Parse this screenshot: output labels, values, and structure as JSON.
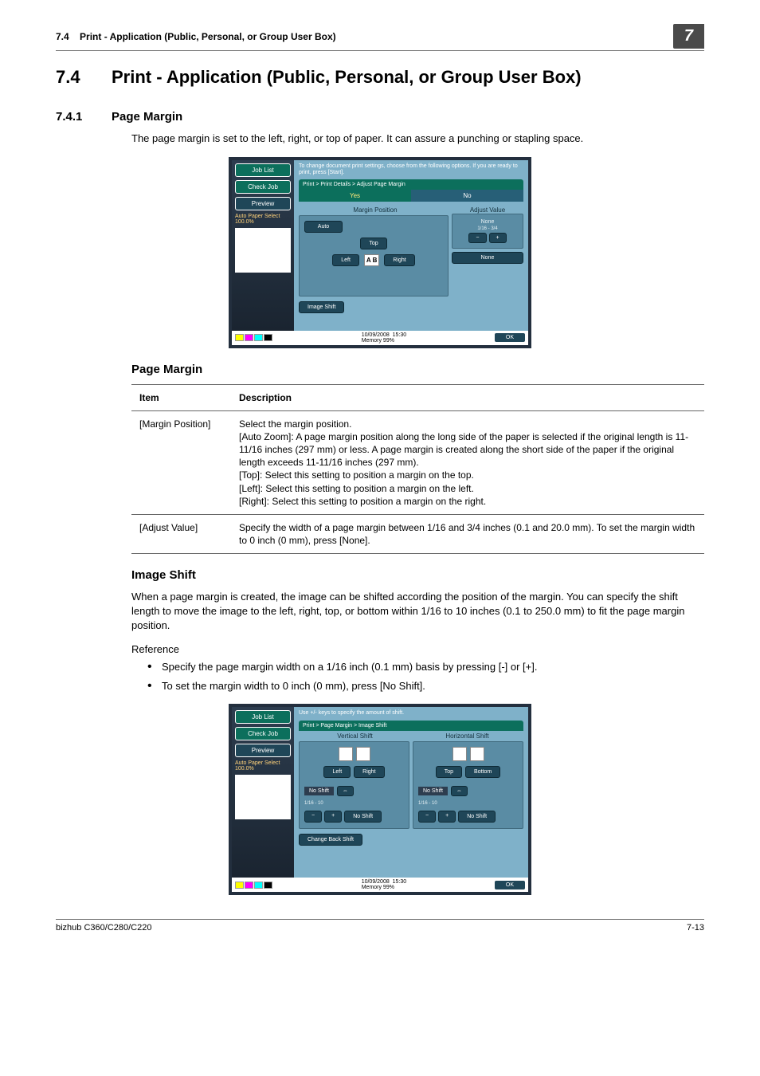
{
  "header": {
    "section_num": "7.4",
    "section_title": "Print - Application (Public, Personal, or Group User Box)",
    "chapter_badge": "7"
  },
  "h1": {
    "num": "7.4",
    "title": "Print - Application (Public, Personal, or Group User Box)"
  },
  "sec1": {
    "num": "7.4.1",
    "title": "Page Margin",
    "body": "The page margin is set to the left, right, or top of paper. It can assure a punching or stapling space."
  },
  "shot1": {
    "side_joblist": "Job List",
    "side_checkjob": "Check Job",
    "side_preview": "Preview",
    "side_autopaper": "Auto Paper Select  100.0%",
    "instr": "To change document print settings, choose from the following options. If you are ready to print, press [Start].",
    "breadcrumb": "Print > Print Details > Adjust Page Margin",
    "yes": "Yes",
    "no": "No",
    "col1": "Margin Position",
    "col2": "Adjust Value",
    "btn_auto": "Auto",
    "btn_top": "Top",
    "btn_left": "Left",
    "btn_right": "Right",
    "adj_none": "None",
    "adj_frac": "1/16   -   3/4",
    "btn_none2": "None",
    "btn_imageshift": "Image Shift",
    "status_date": "10/09/2008",
    "status_time": "15:30",
    "status_mem": "Memory  99%",
    "ok": "OK"
  },
  "tbl1": {
    "h_item": "Item",
    "h_desc": "Description",
    "r1_item": "[Margin Position]",
    "r1_desc": "Select the margin position.\n[Auto Zoom]: A page margin position along the long side of the paper is selected if the original length is 11-11/16 inches (297 mm) or less. A page margin is created along the short side of the paper if the original length exceeds 11-11/16 inches (297 mm).\n[Top]: Select this setting to position a margin on the top.\n[Left]: Select this setting to position a margin on the left.\n[Right]: Select this setting to position a margin on the right.",
    "r2_item": "[Adjust Value]",
    "r2_desc": "Specify the width of a page margin between 1/16 and 3/4 inches (0.1 and 20.0 mm). To set the margin width to 0 inch (0 mm), press [None]."
  },
  "sec2": {
    "title": "Image Shift",
    "body": "When a page margin is created, the image can be shifted according the position of the margin. You can specify the shift length to move the image to the left, right, top, or bottom within 1/16 to 10 inches (0.1 to 250.0 mm) to fit the page margin position.",
    "ref_label": "Reference",
    "ref1": "Specify the page margin width on a 1/16 inch (0.1 mm) basis by pressing [-] or [+].",
    "ref2": "To set the margin width to 0 inch (0 mm), press [No Shift]."
  },
  "shot2": {
    "instr": "Use +/- keys to specify the amount of shift.",
    "breadcrumb": "Print > Page Margin > Image Shift",
    "colV": "Vertical Shift",
    "colH": "Horizontal Shift",
    "btn_left": "Left",
    "btn_right": "Right",
    "btn_top": "Top",
    "btn_bottom": "Bottom",
    "noshift": "No Shift",
    "val": "1/16  -  10",
    "btn_changeback": "Change Back Shift"
  },
  "footer": {
    "left": "bizhub C360/C280/C220",
    "right": "7-13"
  }
}
